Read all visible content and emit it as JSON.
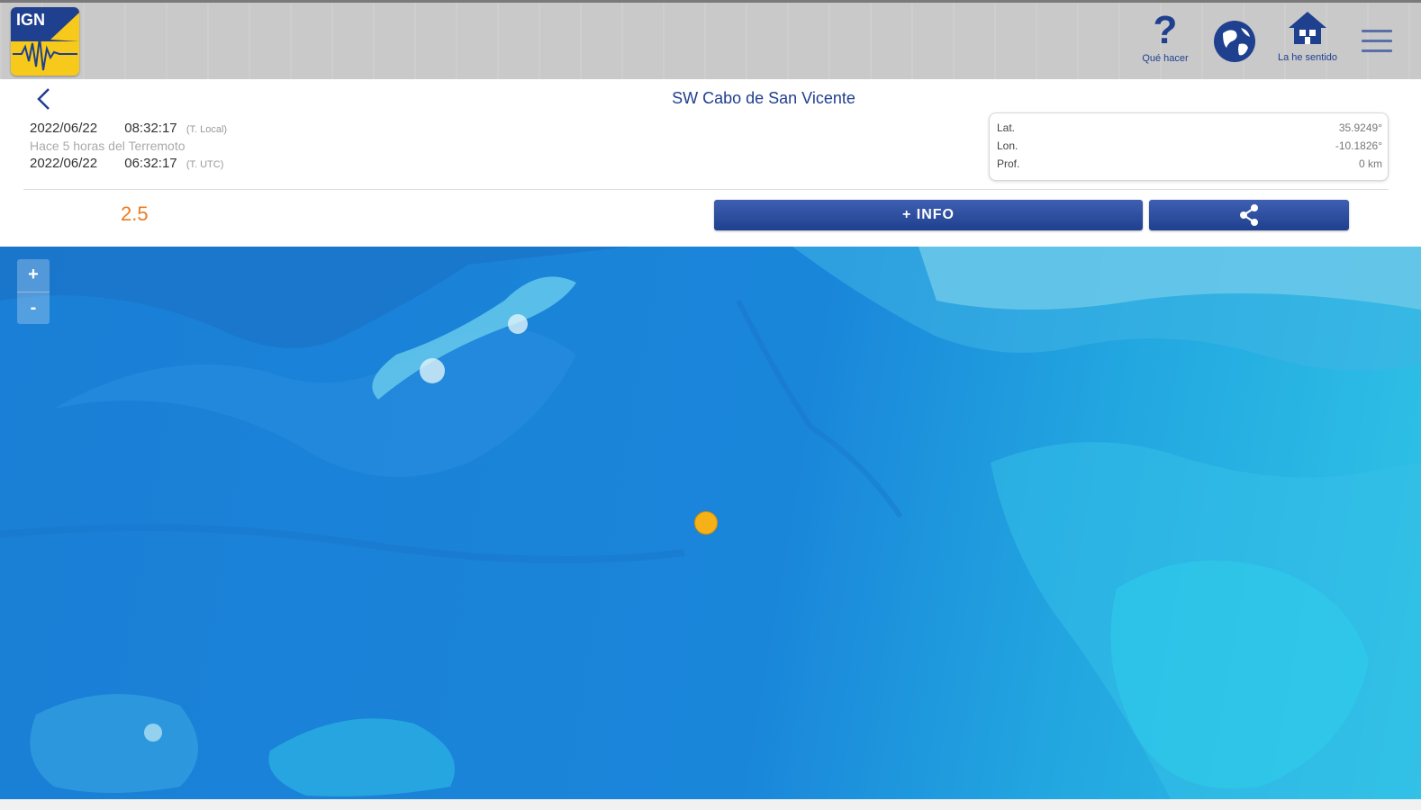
{
  "app": {
    "logo_text": "IGN",
    "toolbar": {
      "help_label": "Qué hacer",
      "home_label": "La he sentido"
    }
  },
  "event": {
    "location": "SW Cabo de San Vicente",
    "local_date": "2022/06/22",
    "local_time": "08:32:17",
    "local_tz": "(T. Local)",
    "ago": "Hace 5 horas del Terremoto",
    "utc_date": "2022/06/22",
    "utc_time": "06:32:17",
    "utc_tz": "(T. UTC)",
    "magnitude": "2.5",
    "lat_label": "Lat.",
    "lat_value": "35.9249°",
    "lon_label": "Lon.",
    "lon_value": "-10.1826°",
    "depth_label": "Prof.",
    "depth_value": "0 km"
  },
  "actions": {
    "info_label": "+ INFO"
  },
  "map": {
    "zoom_in": "+",
    "zoom_out": "-"
  },
  "colors": {
    "brand_blue": "#1f3f8f",
    "brand_yellow": "#f6c91a",
    "magnitude_orange": "#f07a1e",
    "quake_marker": "#f6b018"
  },
  "icons": [
    "back-chevron-icon",
    "help-question-icon",
    "globe-icon",
    "house-icon",
    "hamburger-menu-icon",
    "share-icon",
    "seismograph-logo"
  ]
}
